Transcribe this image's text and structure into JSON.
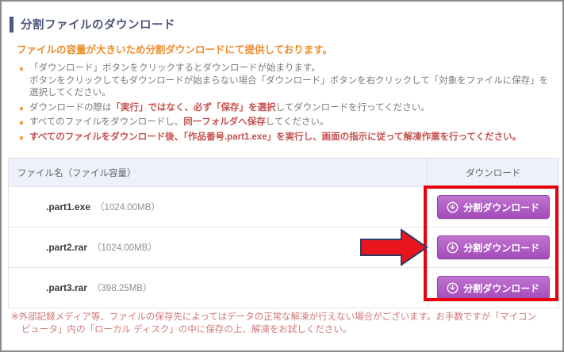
{
  "header": {
    "title": "分割ファイルのダウンロード"
  },
  "intro": "ファイルの容量が大きいため分割ダウンロードにて提供しております。",
  "notes": [
    {
      "segments": [
        {
          "text": "「ダウンロード」ボタンをクリックするとダウンロードが始まります。\nボタンをクリックしてもダウンロードが始まらない場合「ダウンロード」ボタンを右クリックして「対象をファイルに保存」を\n選択してください。",
          "style": "normal"
        }
      ]
    },
    {
      "segments": [
        {
          "text": "ダウンロードの際は",
          "style": "normal"
        },
        {
          "text": "「実行」ではなく、必ず「保存」を選択",
          "style": "red"
        },
        {
          "text": "してダウンロードを行ってください。",
          "style": "normal"
        }
      ]
    },
    {
      "segments": [
        {
          "text": "すべてのファイルをダウンロードし、",
          "style": "normal"
        },
        {
          "text": "同一フォルダへ保存",
          "style": "red"
        },
        {
          "text": "してください。",
          "style": "normal"
        }
      ]
    },
    {
      "segments": [
        {
          "text": "すべてのファイルをダウンロード後、「作品番号.part1.exe」を実行し、画面の指示に従って解凍作業を行ってください。",
          "style": "red"
        }
      ]
    }
  ],
  "table": {
    "headers": {
      "file": "ファイル名（ファイル容量）",
      "download": "ダウンロード"
    },
    "rows": [
      {
        "name": ".part1.exe",
        "size": "（1024.00MB）",
        "button": "分割ダウンロード"
      },
      {
        "name": ".part2.rar",
        "size": "（1024.00MB）",
        "button": "分割ダウンロード"
      },
      {
        "name": ".part3.rar",
        "size": "（398.25MB）",
        "button": "分割ダウンロード"
      }
    ]
  },
  "footer_note": "※外部記録メディア等、ファイルの保存先によってはデータの正常な解凍が行えない場合がございます。お手数ですが「マイコン\nピュータ」内の「ローカル ディスク」の中に保存の上、解凍をお試しください。",
  "icons": {
    "download_button_icon": "circle-down-arrow",
    "highlight_rectangle": "red-outline-box",
    "pointer_arrow": "red-right-arrow"
  },
  "colors": {
    "title_navy": "#4a5578",
    "accent_orange": "#ee8e2b",
    "emphasis_red": "#c4514f",
    "footer_red": "#d17878",
    "button_purple": "#a44cba",
    "annotation_red": "#e8000d",
    "table_header_bg": "#eef1f8"
  }
}
